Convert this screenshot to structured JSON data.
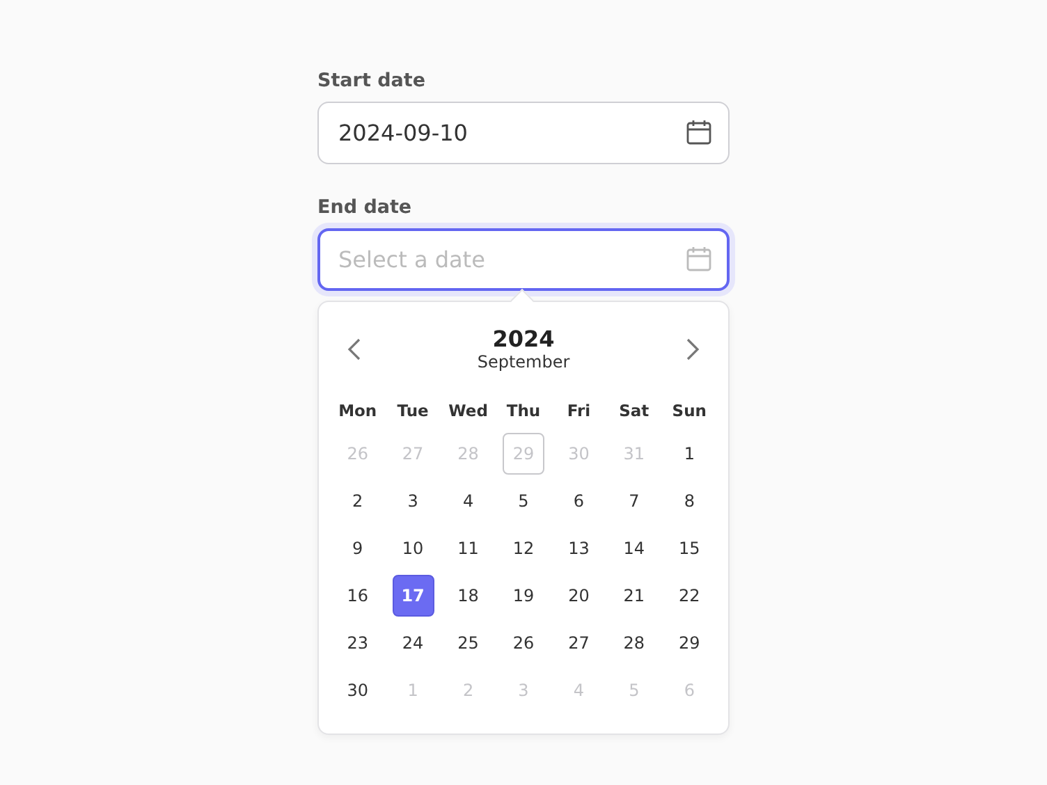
{
  "fields": [
    {
      "label": "Start date",
      "value": "2024-09-10",
      "focused": false
    },
    {
      "label": "End date",
      "placeholder": "Select a date",
      "focused": true
    }
  ],
  "calendar": {
    "year": "2024",
    "month": "September",
    "weekdays": [
      "Mon",
      "Tue",
      "Wed",
      "Thu",
      "Fri",
      "Sat",
      "Sun"
    ],
    "weeks": [
      [
        {
          "day": "26",
          "outside": true,
          "selected": false,
          "outlined": false
        },
        {
          "day": "27",
          "outside": true,
          "selected": false,
          "outlined": false
        },
        {
          "day": "28",
          "outside": true,
          "selected": false,
          "outlined": false
        },
        {
          "day": "29",
          "outside": true,
          "selected": false,
          "outlined": true
        },
        {
          "day": "30",
          "outside": true,
          "selected": false,
          "outlined": false
        },
        {
          "day": "31",
          "outside": true,
          "selected": false,
          "outlined": false
        },
        {
          "day": "1",
          "outside": false,
          "selected": false,
          "outlined": false
        }
      ],
      [
        {
          "day": "2",
          "outside": false,
          "selected": false,
          "outlined": false
        },
        {
          "day": "3",
          "outside": false,
          "selected": false,
          "outlined": false
        },
        {
          "day": "4",
          "outside": false,
          "selected": false,
          "outlined": false
        },
        {
          "day": "5",
          "outside": false,
          "selected": false,
          "outlined": false
        },
        {
          "day": "6",
          "outside": false,
          "selected": false,
          "outlined": false
        },
        {
          "day": "7",
          "outside": false,
          "selected": false,
          "outlined": false
        },
        {
          "day": "8",
          "outside": false,
          "selected": false,
          "outlined": false
        }
      ],
      [
        {
          "day": "9",
          "outside": false,
          "selected": false,
          "outlined": false
        },
        {
          "day": "10",
          "outside": false,
          "selected": false,
          "outlined": false
        },
        {
          "day": "11",
          "outside": false,
          "selected": false,
          "outlined": false
        },
        {
          "day": "12",
          "outside": false,
          "selected": false,
          "outlined": false
        },
        {
          "day": "13",
          "outside": false,
          "selected": false,
          "outlined": false
        },
        {
          "day": "14",
          "outside": false,
          "selected": false,
          "outlined": false
        },
        {
          "day": "15",
          "outside": false,
          "selected": false,
          "outlined": false
        }
      ],
      [
        {
          "day": "16",
          "outside": false,
          "selected": false,
          "outlined": false
        },
        {
          "day": "17",
          "outside": false,
          "selected": true,
          "outlined": false
        },
        {
          "day": "18",
          "outside": false,
          "selected": false,
          "outlined": false
        },
        {
          "day": "19",
          "outside": false,
          "selected": false,
          "outlined": false
        },
        {
          "day": "20",
          "outside": false,
          "selected": false,
          "outlined": false
        },
        {
          "day": "21",
          "outside": false,
          "selected": false,
          "outlined": false
        },
        {
          "day": "22",
          "outside": false,
          "selected": false,
          "outlined": false
        }
      ],
      [
        {
          "day": "23",
          "outside": false,
          "selected": false,
          "outlined": false
        },
        {
          "day": "24",
          "outside": false,
          "selected": false,
          "outlined": false
        },
        {
          "day": "25",
          "outside": false,
          "selected": false,
          "outlined": false
        },
        {
          "day": "26",
          "outside": false,
          "selected": false,
          "outlined": false
        },
        {
          "day": "27",
          "outside": false,
          "selected": false,
          "outlined": false
        },
        {
          "day": "28",
          "outside": false,
          "selected": false,
          "outlined": false
        },
        {
          "day": "29",
          "outside": false,
          "selected": false,
          "outlined": false
        }
      ],
      [
        {
          "day": "30",
          "outside": false,
          "selected": false,
          "outlined": false
        },
        {
          "day": "1",
          "outside": true,
          "selected": false,
          "outlined": false
        },
        {
          "day": "2",
          "outside": true,
          "selected": false,
          "outlined": false
        },
        {
          "day": "3",
          "outside": true,
          "selected": false,
          "outlined": false
        },
        {
          "day": "4",
          "outside": true,
          "selected": false,
          "outlined": false
        },
        {
          "day": "5",
          "outside": true,
          "selected": false,
          "outlined": false
        },
        {
          "day": "6",
          "outside": true,
          "selected": false,
          "outlined": false
        }
      ]
    ]
  }
}
